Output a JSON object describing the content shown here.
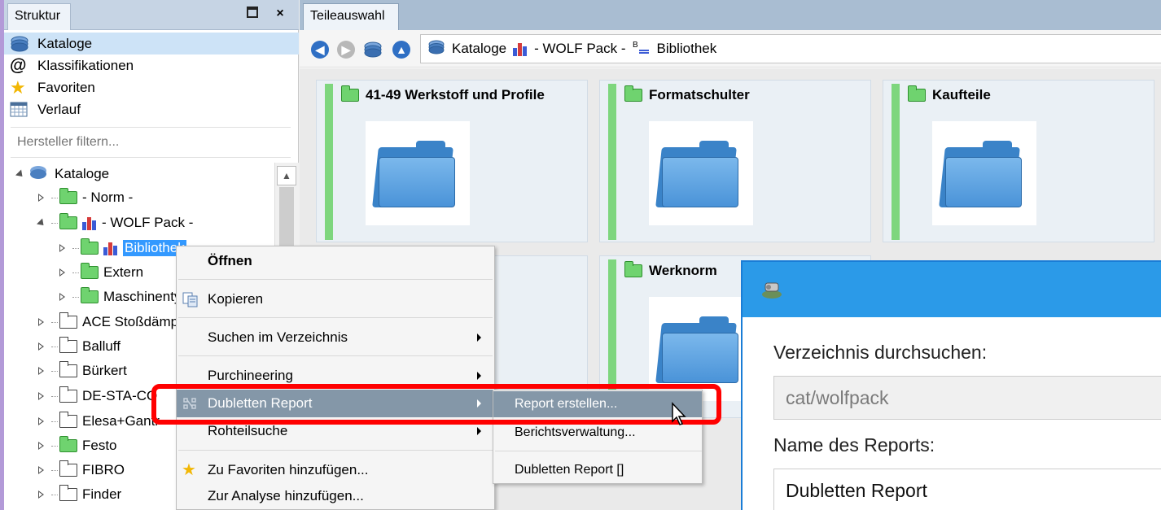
{
  "structure_panel": {
    "tab_label": "Struktur",
    "nav_items": [
      {
        "label": "Kataloge",
        "icon": "catalog-icon",
        "selected": true
      },
      {
        "label": "Klassifikationen",
        "icon": "at-icon",
        "selected": false
      },
      {
        "label": "Favoriten",
        "icon": "star-icon",
        "selected": false
      },
      {
        "label": "Verlauf",
        "icon": "calendar-icon",
        "selected": false
      }
    ],
    "filter_placeholder": "Hersteller filtern...",
    "tree": [
      {
        "label": "Kataloge",
        "level": 0,
        "state": "open",
        "icon": "catalog-icon"
      },
      {
        "label": "- Norm -",
        "level": 1,
        "state": "closed",
        "icon": "green-folder-icon"
      },
      {
        "label": "- WOLF Pack  -",
        "level": 1,
        "state": "open",
        "icon": "open-green-folder-icon"
      },
      {
        "label": "Bibliothek",
        "level": 2,
        "state": "closed",
        "icon": "green-folder-icon",
        "selected": true
      },
      {
        "label": "Extern",
        "level": 2,
        "state": "closed",
        "icon": "green-folder-icon"
      },
      {
        "label": "Maschinenty",
        "level": 2,
        "state": "closed",
        "icon": "green-folder-icon"
      },
      {
        "label": "ACE Stoßdämp",
        "level": 1,
        "state": "closed",
        "icon": "white-folder-icon"
      },
      {
        "label": "Balluff",
        "level": 1,
        "state": "closed",
        "icon": "white-folder-icon"
      },
      {
        "label": "Bürkert",
        "level": 1,
        "state": "closed",
        "icon": "white-folder-icon"
      },
      {
        "label": "DE-STA-CO",
        "level": 1,
        "state": "closed",
        "icon": "white-folder-icon"
      },
      {
        "label": "Elesa+Gantr",
        "level": 1,
        "state": "closed",
        "icon": "white-folder-icon"
      },
      {
        "label": "Festo",
        "level": 1,
        "state": "closed",
        "icon": "green-folder-icon"
      },
      {
        "label": "FIBRO",
        "level": 1,
        "state": "closed",
        "icon": "white-folder-icon"
      },
      {
        "label": "Finder",
        "level": 1,
        "state": "closed",
        "icon": "white-folder-icon"
      }
    ]
  },
  "parts_panel": {
    "tab_label": "Teileauswahl",
    "path": [
      "Kataloge",
      "- WOLF Pack  -",
      "Bibliothek"
    ],
    "cards": [
      {
        "title": "41-49 Werkstoff und Profile"
      },
      {
        "title": "Formatschulter"
      },
      {
        "title": "Kaufteile"
      },
      {
        "title": ""
      },
      {
        "title": "Werknorm"
      }
    ]
  },
  "context_menu": {
    "items": [
      {
        "label": "Öffnen",
        "bold": true,
        "submenu": false,
        "icon": ""
      },
      {
        "label": "Kopieren",
        "bold": false,
        "submenu": false,
        "icon": "copy-icon"
      },
      {
        "label": "Suchen im Verzeichnis",
        "bold": false,
        "submenu": true,
        "icon": ""
      },
      {
        "label": "Purchineering",
        "bold": false,
        "submenu": true,
        "icon": ""
      },
      {
        "label": "Dubletten Report",
        "bold": false,
        "submenu": true,
        "icon": "duplicate-report-icon",
        "highlighted": true
      },
      {
        "label": "Rohteilsuche",
        "bold": false,
        "submenu": true,
        "icon": ""
      },
      {
        "label": "Zu Favoriten hinzufügen...",
        "bold": false,
        "submenu": false,
        "icon": "star-icon"
      },
      {
        "label": "Zur Analyse hinzufügen...",
        "bold": false,
        "submenu": false,
        "icon": ""
      }
    ]
  },
  "submenu": {
    "items": [
      {
        "label": "Report erstellen...",
        "highlighted": true
      },
      {
        "label": "Berichtsverwaltung...",
        "highlighted": false
      },
      {
        "label": "Dubletten Report []",
        "highlighted": false
      }
    ]
  },
  "dialog": {
    "search_label": "Verzeichnis durchsuchen:",
    "search_value": "cat/wolfpack",
    "name_label": "Name des Reports:",
    "name_value": "Dubletten Report"
  },
  "colors": {
    "highlight": "#8497a8",
    "selection": "#3399ff",
    "annotation_frame": "#ff0000",
    "dialog_title": "#2b9ae8",
    "card_accent": "#7ed67e"
  }
}
